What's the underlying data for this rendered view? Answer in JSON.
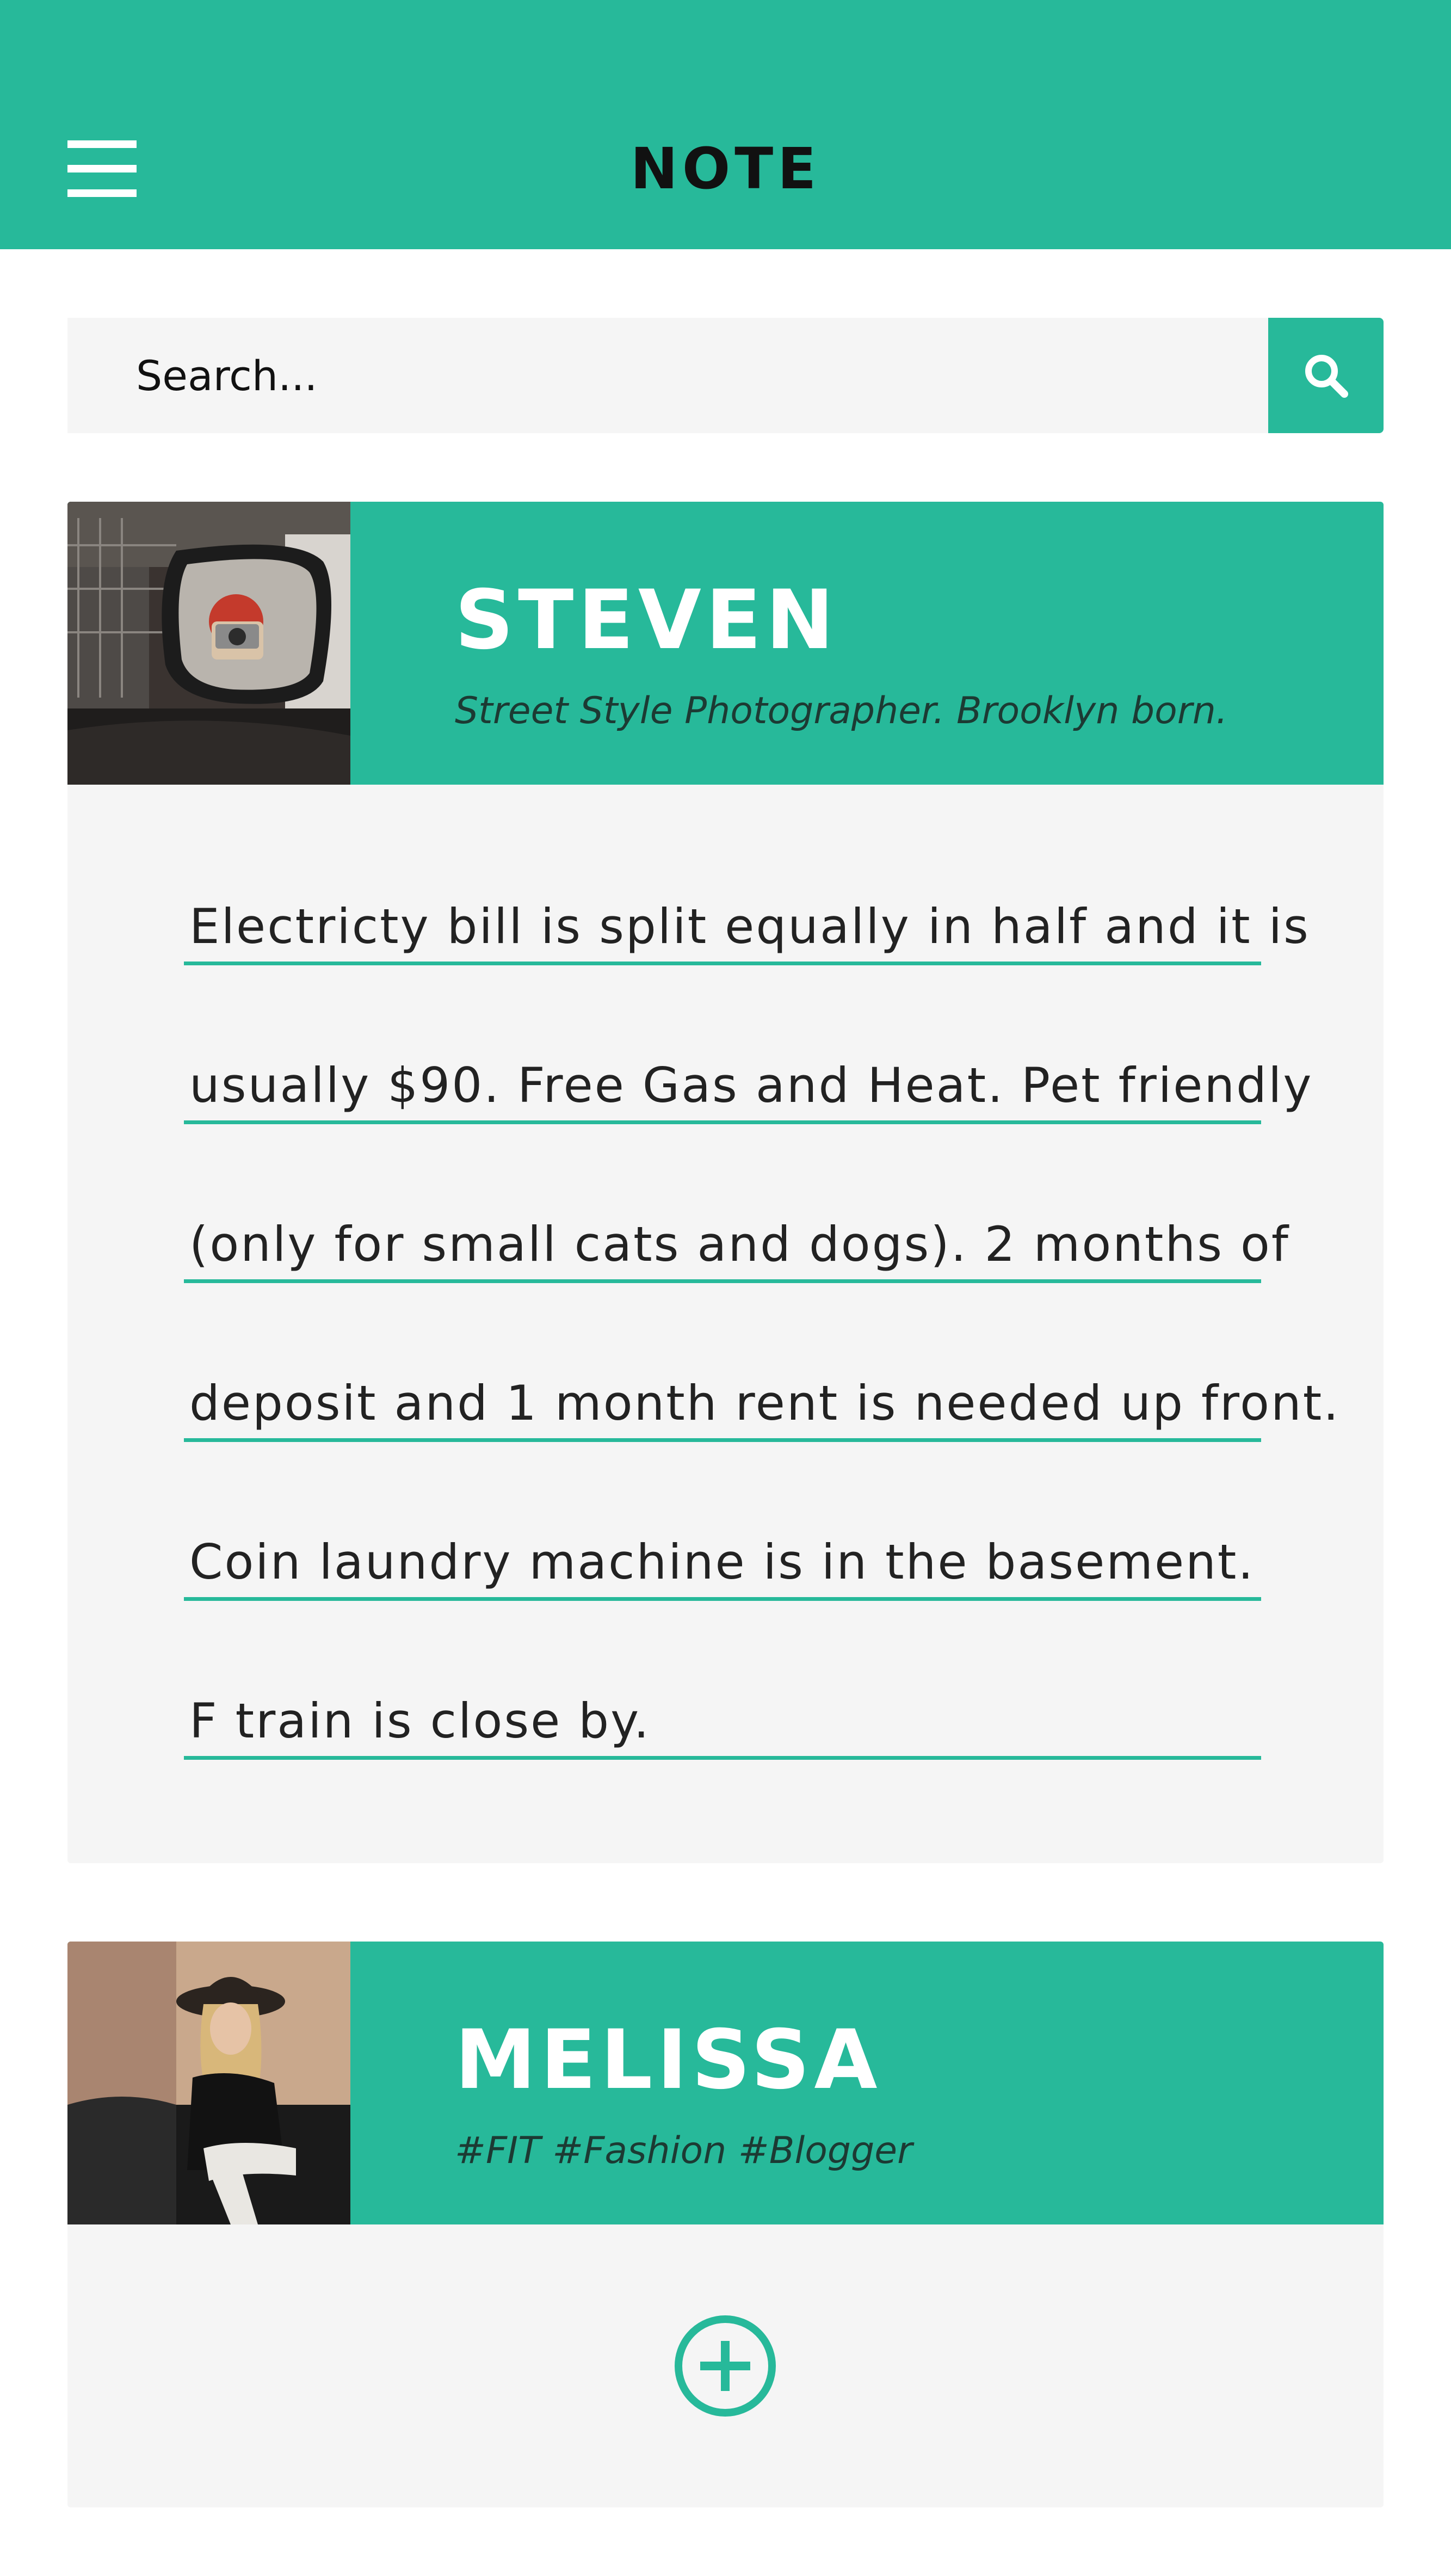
{
  "header": {
    "title": "NOTE",
    "menu_icon": "hamburger-menu-icon",
    "accent_color": "#27b99a"
  },
  "search": {
    "placeholder": "Search...",
    "icon": "search-icon"
  },
  "contacts": [
    {
      "name": "STEVEN",
      "bio": "Street Style Photographer. Brooklyn born.",
      "avatar": "photo-person-with-camera-in-car-mirror",
      "note_lines": [
        "Electricty bill is split equally in half and it is",
        "usually $90. Free Gas and Heat. Pet friendly",
        "(only for small cats and dogs). 2 months of",
        "deposit and 1 month rent is needed up front.",
        "Coin laundry machine is in the basement.",
        "F train is close by."
      ]
    },
    {
      "name": "MELISSA",
      "bio": "#FIT #Fashion #Blogger",
      "avatar": "photo-woman-in-hat-on-sofa",
      "add_icon": "plus-circle-icon"
    }
  ]
}
